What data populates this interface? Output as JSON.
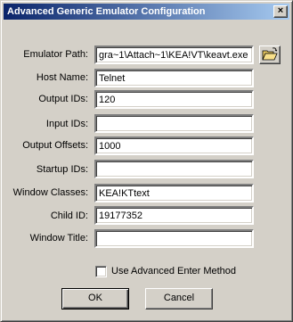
{
  "window": {
    "title": "Advanced Generic Emulator Configuration",
    "close_glyph": "×"
  },
  "fields": [
    {
      "label": "Emulator Path:",
      "value": "gra~1\\Attach~1\\KEA!VT\\keavt.exe"
    },
    {
      "label": "Host Name:",
      "value": "Telnet"
    },
    {
      "label": "Output IDs:",
      "value": "120"
    },
    {
      "label": "Input IDs:",
      "value": ""
    },
    {
      "label": "Output Offsets:",
      "value": "1000"
    },
    {
      "label": "Startup IDs:",
      "value": ""
    },
    {
      "label": "Window Classes:",
      "value": "KEA!KTtext"
    },
    {
      "label": "Child ID:",
      "value": "19177352"
    },
    {
      "label": "Window Title:",
      "value": ""
    }
  ],
  "browse_icon": "folder-open-icon",
  "checkbox": {
    "label": "Use Advanced Enter Method",
    "checked": false
  },
  "buttons": {
    "ok": "OK",
    "cancel": "Cancel"
  },
  "colors": {
    "titlebar_start": "#0a246a",
    "titlebar_end": "#a6caf0",
    "face": "#d4d0c8"
  }
}
